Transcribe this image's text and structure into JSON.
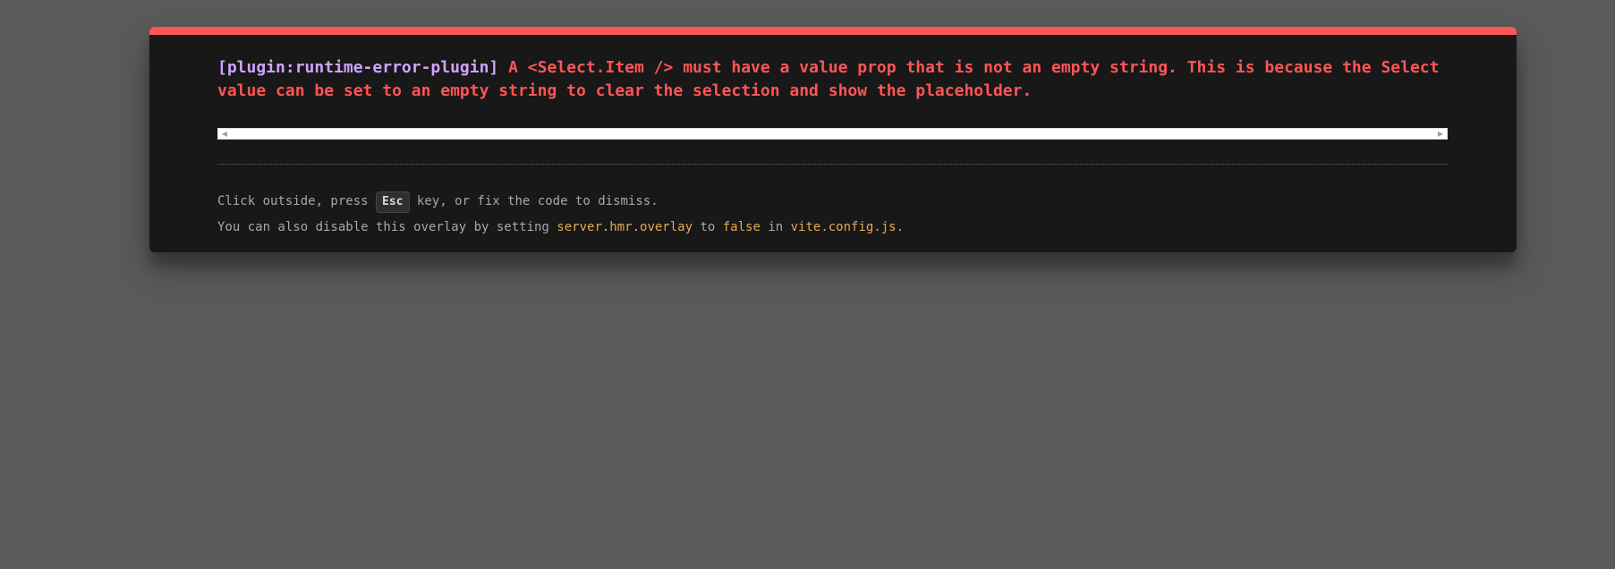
{
  "overlay": {
    "plugin_label": "[plugin:runtime-error-plugin]",
    "message": "A <Select.Item /> must have a value prop that is not an empty string. This is because the Select value can be set to an empty string to clear the selection and show the placeholder.",
    "scrollbar": {
      "left_arrow": "◀",
      "right_arrow": "▶"
    },
    "tip": {
      "line1_before": "Click outside, press ",
      "key": "Esc",
      "line1_after": " key, or fix the code to dismiss.",
      "line2_before": "You can also disable this overlay by setting ",
      "code1": "server.hmr.overlay",
      "line2_mid1": " to ",
      "code2": "false",
      "line2_mid2": " in ",
      "code3": "vite.config.js",
      "line2_after": "."
    }
  },
  "colors": {
    "backdrop": "#5a5a5a",
    "window_bg": "#181818",
    "accent_red": "#ff5555",
    "plugin_purple": "#cfa4ff",
    "code_yellow": "#e2aa53",
    "tip_text": "#a8a8a8"
  }
}
